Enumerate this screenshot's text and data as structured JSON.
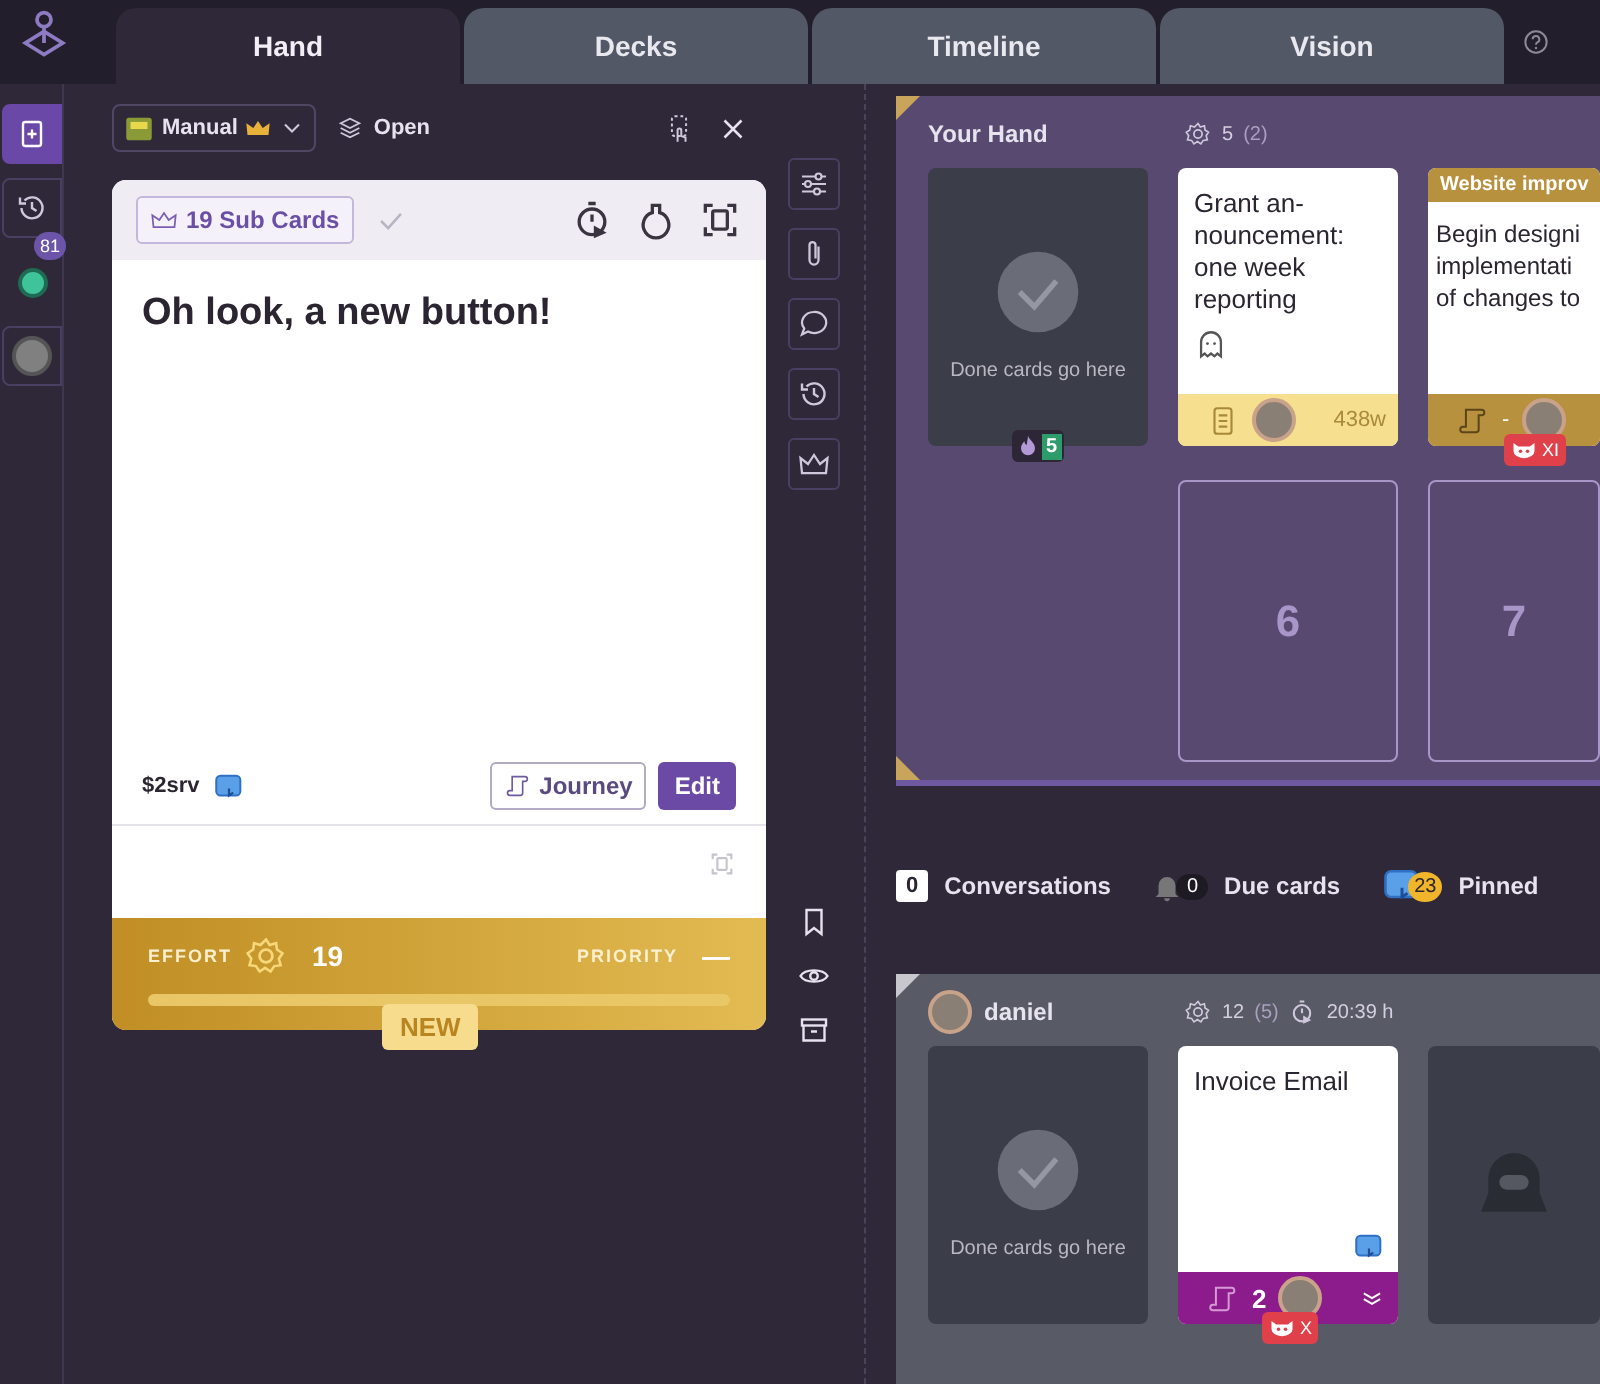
{
  "tabs": [
    {
      "label": "Hand",
      "selected": true
    },
    {
      "label": "Decks",
      "selected": false
    },
    {
      "label": "Timeline",
      "selected": false
    },
    {
      "label": "Vision",
      "selected": false
    }
  ],
  "rail": [
    {
      "kind": "new-card",
      "selected": true
    },
    {
      "kind": "history",
      "selected": false
    },
    {
      "kind": "status",
      "selected": false,
      "badge": "81"
    },
    {
      "kind": "avatar",
      "selected": false
    }
  ],
  "card_panel": {
    "deck": "Manual",
    "status": "Open",
    "card": {
      "sub_cards": "19 Sub Cards",
      "title": "Oh look, a new button!",
      "code": "$2srv",
      "buttons": [
        {
          "kind": "journey",
          "label": "Journey"
        },
        {
          "kind": "edit",
          "label": "Edit"
        }
      ],
      "effort_label": "EFFORT",
      "effort": "19",
      "priority_label": "PRIORITY",
      "priority": "—",
      "badge": "NEW"
    },
    "tools": [
      {
        "kind": "settings"
      },
      {
        "kind": "attachment"
      },
      {
        "kind": "comment"
      },
      {
        "kind": "history"
      },
      {
        "kind": "crown"
      }
    ],
    "side_actions": [
      {
        "kind": "bookmark"
      },
      {
        "kind": "watch"
      },
      {
        "kind": "archive"
      }
    ]
  },
  "hand": {
    "title": "Your Hand",
    "effort": "5",
    "effort_extra": "(2)",
    "done_text": "Done cards go here",
    "done_count": "5",
    "cards": [
      {
        "kind": "document",
        "title": "Grant an-nouncement: one week reporting",
        "color": "#f6df8e",
        "footer_text": "438w"
      },
      {
        "kind": "journey",
        "header": "Website improv",
        "title": "Begin designi implementati of changes to",
        "color": "#b8913e",
        "footer_text": "-",
        "tag": "XI"
      }
    ],
    "slots": [
      "6",
      "7"
    ]
  },
  "counters": [
    {
      "kind": "conversations",
      "count": "0",
      "label": "Conversations"
    },
    {
      "kind": "due",
      "count": "0",
      "label": "Due cards"
    },
    {
      "kind": "pinned",
      "count": "23",
      "label": "Pinned"
    }
  ],
  "user_panel": {
    "name": "daniel",
    "effort": "12",
    "effort_extra": "(5)",
    "time": "20:39 h",
    "done_text": "Done cards go here",
    "cards": [
      {
        "title": "Invoice Email",
        "color": "#8c1c8c",
        "count": "2",
        "tag": "X"
      }
    ]
  }
}
